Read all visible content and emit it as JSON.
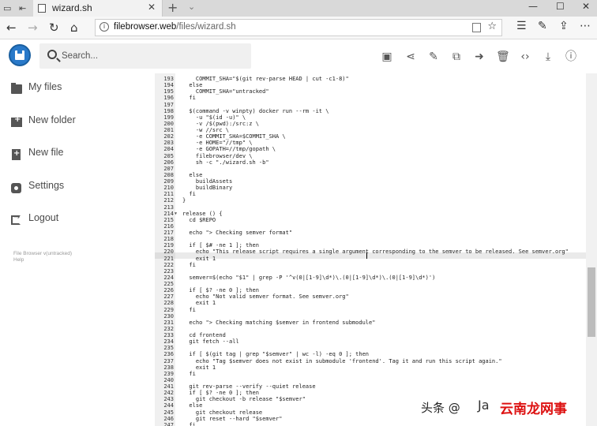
{
  "browser": {
    "tab_title": "wizard.sh",
    "url_domain": "filebrowser.web",
    "url_path": "/files/wizard.sh"
  },
  "header": {
    "search_placeholder": "Search..."
  },
  "sidebar": {
    "items": [
      {
        "label": "My files",
        "icon": "folder-icon"
      },
      {
        "label": "New folder",
        "icon": "create-new-folder-icon"
      },
      {
        "label": "New file",
        "icon": "note-add-icon"
      },
      {
        "label": "Settings",
        "icon": "settings-icon"
      },
      {
        "label": "Logout",
        "icon": "exit-icon"
      }
    ],
    "footer_version": "File Browser v(untracked)",
    "footer_help": "Help"
  },
  "editor": {
    "active_line": 221,
    "lines": [
      {
        "n": "193",
        "t": "    COMMIT_SHA=\"$(git rev-parse HEAD | cut -c1-8)\""
      },
      {
        "n": "194",
        "t": "  else"
      },
      {
        "n": "195",
        "t": "    COMMIT_SHA=\"untracked\""
      },
      {
        "n": "196",
        "t": "  fi"
      },
      {
        "n": "197",
        "t": ""
      },
      {
        "n": "198",
        "t": "  $(command -v winpty) docker run --rm -it \\"
      },
      {
        "n": "199",
        "t": "    -u \"$(id -u)\" \\"
      },
      {
        "n": "200",
        "t": "    -v /$(pwd):/src:z \\"
      },
      {
        "n": "201",
        "t": "    -w //src \\"
      },
      {
        "n": "202",
        "t": "    -e COMMIT_SHA=$COMMIT_SHA \\"
      },
      {
        "n": "203",
        "t": "    -e HOME=\"//tmp\" \\"
      },
      {
        "n": "204",
        "t": "    -e GOPATH=//tmp/gopath \\"
      },
      {
        "n": "205",
        "t": "    filebrowser/dev \\"
      },
      {
        "n": "206",
        "t": "    sh -c \"./wizard.sh -b\""
      },
      {
        "n": "207",
        "t": ""
      },
      {
        "n": "208",
        "t": "  else"
      },
      {
        "n": "209",
        "t": "    buildAssets"
      },
      {
        "n": "210",
        "t": "    buildBinary"
      },
      {
        "n": "211",
        "t": "  fi"
      },
      {
        "n": "212",
        "t": "}"
      },
      {
        "n": "213",
        "t": ""
      },
      {
        "n": "214",
        "t": "release () {",
        "fold": true
      },
      {
        "n": "215",
        "t": "  cd $REPO"
      },
      {
        "n": "216",
        "t": ""
      },
      {
        "n": "217",
        "t": "  echo \"> Checking semver format\""
      },
      {
        "n": "218",
        "t": ""
      },
      {
        "n": "219",
        "t": "  if [ $# -ne 1 ]; then"
      },
      {
        "n": "220",
        "t": "    echo \"This release script requires a single argument corresponding to the semver to be released. See semver.org\""
      },
      {
        "n": "221",
        "t": "    exit 1"
      },
      {
        "n": "222",
        "t": "  fi"
      },
      {
        "n": "223",
        "t": ""
      },
      {
        "n": "224",
        "t": "  semver=$(echo \"$1\" | grep -P '^v(0|[1-9]\\d*)\\.(0|[1-9]\\d*)\\.(0|[1-9]\\d*)')"
      },
      {
        "n": "225",
        "t": ""
      },
      {
        "n": "226",
        "t": "  if [ $? -ne 0 ]; then"
      },
      {
        "n": "227",
        "t": "    echo \"Not valid semver format. See semver.org\""
      },
      {
        "n": "228",
        "t": "    exit 1"
      },
      {
        "n": "229",
        "t": "  fi"
      },
      {
        "n": "230",
        "t": ""
      },
      {
        "n": "231",
        "t": "  echo \"> Checking matching $semver in frontend submodule\""
      },
      {
        "n": "232",
        "t": ""
      },
      {
        "n": "233",
        "t": "  cd frontend"
      },
      {
        "n": "234",
        "t": "  git fetch --all"
      },
      {
        "n": "235",
        "t": ""
      },
      {
        "n": "236",
        "t": "  if [ $(git tag | grep \"$semver\" | wc -l) -eq 0 ]; then"
      },
      {
        "n": "237",
        "t": "    echo \"Tag $semver does not exist in submodule 'frontend'. Tag it and run this script again.\""
      },
      {
        "n": "238",
        "t": "    exit 1"
      },
      {
        "n": "239",
        "t": "  fi"
      },
      {
        "n": "240",
        "t": ""
      },
      {
        "n": "241",
        "t": "  git rev-parse --verify --quiet release"
      },
      {
        "n": "242",
        "t": "  if [ $? -ne 0 ]; then"
      },
      {
        "n": "243",
        "t": "    git checkout -b release \"$semver\""
      },
      {
        "n": "244",
        "t": "  else"
      },
      {
        "n": "245",
        "t": "    git checkout release"
      },
      {
        "n": "246",
        "t": "    git reset --hard \"$semver\""
      },
      {
        "n": "247",
        "t": "  fi"
      }
    ]
  },
  "watermark": {
    "part1": "头条 @",
    "part2": "Ja",
    "part3": "云南龙网事"
  }
}
